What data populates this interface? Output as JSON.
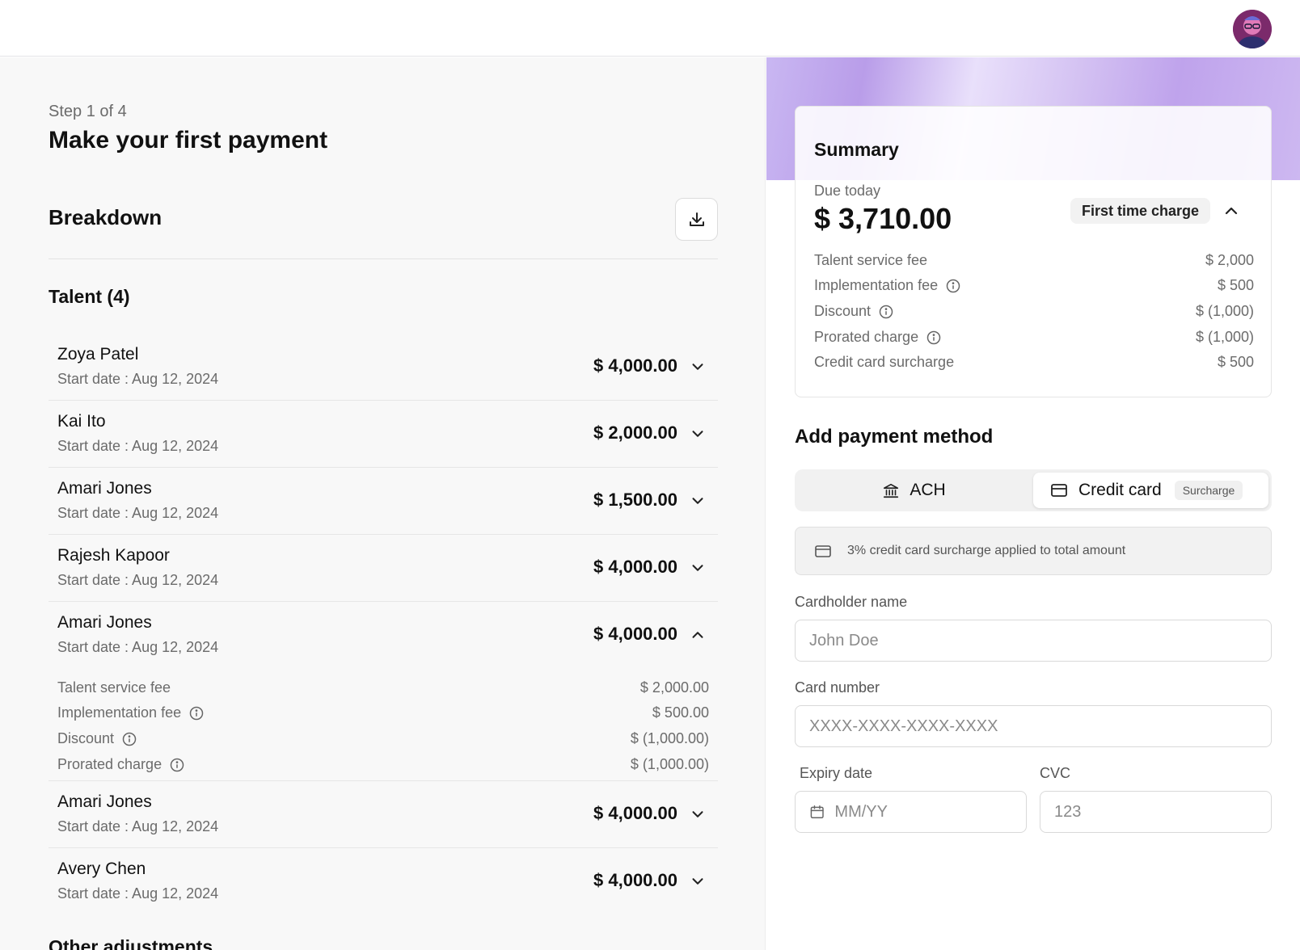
{
  "header": {
    "avatar_label": "user-avatar"
  },
  "main": {
    "step": "Step 1 of 4",
    "title": "Make your first payment",
    "breakdown_title": "Breakdown",
    "talent_heading": "Talent (4)",
    "other_heading": "Other adjustments",
    "rows": [
      {
        "name": "Zoya Patel",
        "date": "Start date : Aug 12, 2024",
        "amount": "$ 4,000.00",
        "expanded": false
      },
      {
        "name": "Kai Ito",
        "date": "Start date : Aug 12, 2024",
        "amount": "$ 2,000.00",
        "expanded": false
      },
      {
        "name": "Amari Jones",
        "date": "Start date : Aug 12, 2024",
        "amount": "$ 1,500.00",
        "expanded": false
      },
      {
        "name": "Rajesh Kapoor",
        "date": "Start date : Aug 12, 2024",
        "amount": "$ 4,000.00",
        "expanded": false
      },
      {
        "name": "Amari Jones",
        "date": "Start date : Aug 12, 2024",
        "amount": "$ 4,000.00",
        "expanded": true
      },
      {
        "name": "Amari Jones",
        "date": "Start date : Aug 12, 2024",
        "amount": "$ 4,000.00",
        "expanded": false
      },
      {
        "name": "Avery Chen",
        "date": "Start date : Aug 12, 2024",
        "amount": "$ 4,000.00",
        "expanded": false
      }
    ],
    "expanded_details": [
      {
        "label": "Talent service fee",
        "value": "$ 2,000.00",
        "info": false
      },
      {
        "label": "Implementation fee",
        "value": "$ 500.00",
        "info": true
      },
      {
        "label": "Discount",
        "value": "$ (1,000.00)",
        "info": true
      },
      {
        "label": "Prorated charge",
        "value": "$ (1,000.00)",
        "info": true
      }
    ]
  },
  "summary": {
    "title": "Summary",
    "due_label": "Due today",
    "due_amount": "$ 3,710.00",
    "badge": "First time charge",
    "items": [
      {
        "label": "Talent service fee",
        "value": "$ 2,000",
        "info": false
      },
      {
        "label": "Implementation fee",
        "value": "$ 500",
        "info": true
      },
      {
        "label": "Discount",
        "value": "$ (1,000)",
        "info": true
      },
      {
        "label": "Prorated charge",
        "value": "$ (1,000)",
        "info": true
      },
      {
        "label": "Credit card surcharge",
        "value": "$ 500",
        "info": false
      }
    ]
  },
  "payment": {
    "title": "Add payment method",
    "ach_label": "ACH",
    "cc_label": "Credit card",
    "surcharge_badge": "Surcharge",
    "notice": "3% credit card surcharge applied to total amount",
    "cardholder_label": "Cardholder name",
    "cardholder_placeholder": "John Doe",
    "card_number_label": "Card number",
    "card_number_placeholder": "XXXX-XXXX-XXXX-XXXX",
    "expiry_label": "Expiry date",
    "expiry_placeholder": "MM/YY",
    "cvc_label": "CVC",
    "cvc_placeholder": "123"
  },
  "colors": {
    "accent_gradient": "#c9b7f2",
    "panel_bg": "#f8f8f8",
    "avatar_bg": "#7b2a6b"
  }
}
